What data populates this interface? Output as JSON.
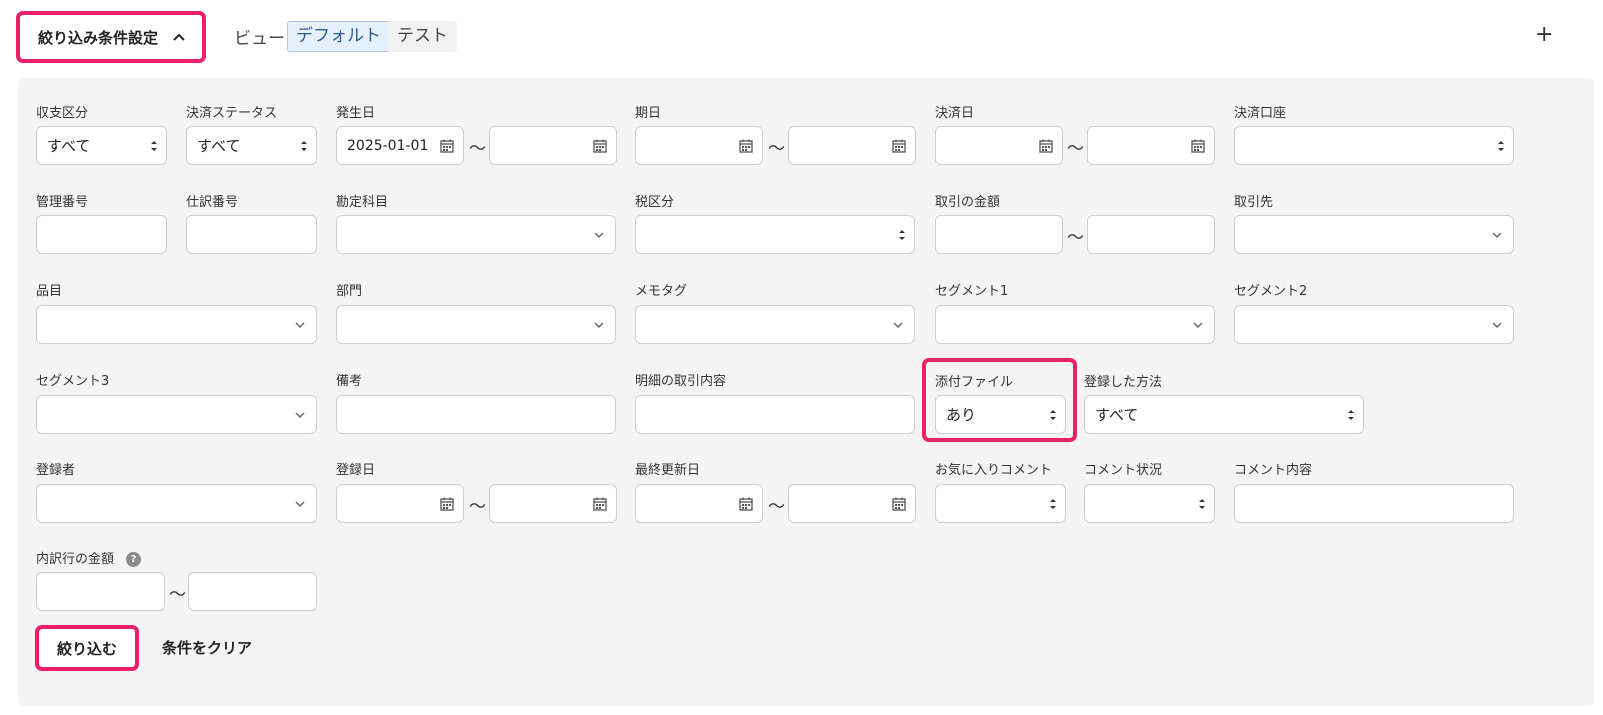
{
  "header": {
    "toggle_label": "絞り込み条件設定",
    "view_label": "ビュー",
    "views": [
      "デフォルト",
      "テスト"
    ],
    "add_label": "+"
  },
  "labels": {
    "income_type": "収支区分",
    "settlement_status": "決済ステータス",
    "issue_date": "発生日",
    "due_date": "期日",
    "settlement_date": "決済日",
    "settlement_account": "決済口座",
    "control_number": "管理番号",
    "journal_number": "仕訳番号",
    "account_item": "勘定科目",
    "tax_category": "税区分",
    "transaction_amount": "取引の金額",
    "partner": "取引先",
    "item": "品目",
    "department": "部門",
    "memo_tag": "メモタグ",
    "segment1": "セグメント1",
    "segment2": "セグメント2",
    "segment3": "セグメント3",
    "remarks": "備考",
    "detail_content": "明細の取引内容",
    "attachment": "添付ファイル",
    "registration_method": "登録した方法",
    "registrant": "登録者",
    "registered_date": "登録日",
    "last_updated": "最終更新日",
    "favorite_comment": "お気に入りコメント",
    "comment_status": "コメント状況",
    "comment_content": "コメント内容",
    "breakdown_amount": "内訳行の金額"
  },
  "values": {
    "income_type": "すべて",
    "settlement_status": "すべて",
    "issue_date_from": "2025-01-01",
    "attachment": "あり",
    "registration_method": "すべて"
  },
  "range_sep": "〜",
  "help_glyph": "?",
  "actions": {
    "submit": "絞り込む",
    "clear": "条件をクリア"
  },
  "colors": {
    "highlight": "#ec1f6a",
    "panel": "#f5f4f5",
    "active_view": "#e6f0fa"
  },
  "icons": [
    "chevron-up-icon",
    "calendar-icon",
    "chevron-down-icon",
    "updown-arrows-icon",
    "help-icon"
  ]
}
